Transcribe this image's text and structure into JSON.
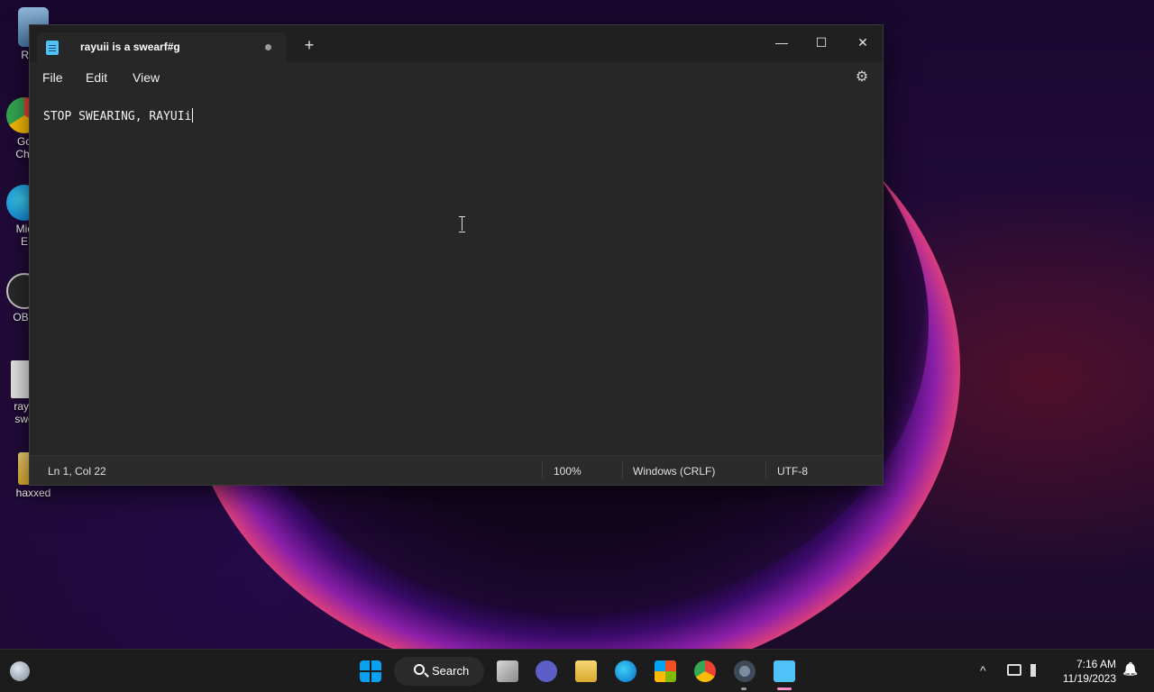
{
  "desktop": {
    "icons": [
      {
        "label": "Recy",
        "icon": "recycle-bin-icon"
      },
      {
        "label": "Go\nChr",
        "icon": "chrome-shortcut-icon"
      },
      {
        "label": "Mic\nE",
        "icon": "edge-shortcut-icon"
      },
      {
        "label": "OBS",
        "icon": "obs-shortcut-icon"
      },
      {
        "label": "rayu\nswe",
        "icon": "text-file-icon"
      },
      {
        "label": "haxxed",
        "icon": "folder-icon"
      }
    ]
  },
  "notepad": {
    "tab_title": "rayuii is a swearf#g",
    "new_tab": "+",
    "controls": {
      "minimize": "—",
      "maximize": "☐",
      "close": "✕"
    },
    "menu": {
      "file": "File",
      "edit": "Edit",
      "view": "View"
    },
    "settings_icon": "⚙",
    "content": "STOP SWEARING, RAYUIi",
    "status": {
      "position": "Ln 1, Col 22",
      "zoom": "100%",
      "line_ending": "Windows (CRLF)",
      "encoding": "UTF-8"
    }
  },
  "taskbar": {
    "search_label": "Search",
    "time": "7:16 AM",
    "date": "11/19/2023",
    "chevron": "^",
    "bell": "🔔"
  }
}
